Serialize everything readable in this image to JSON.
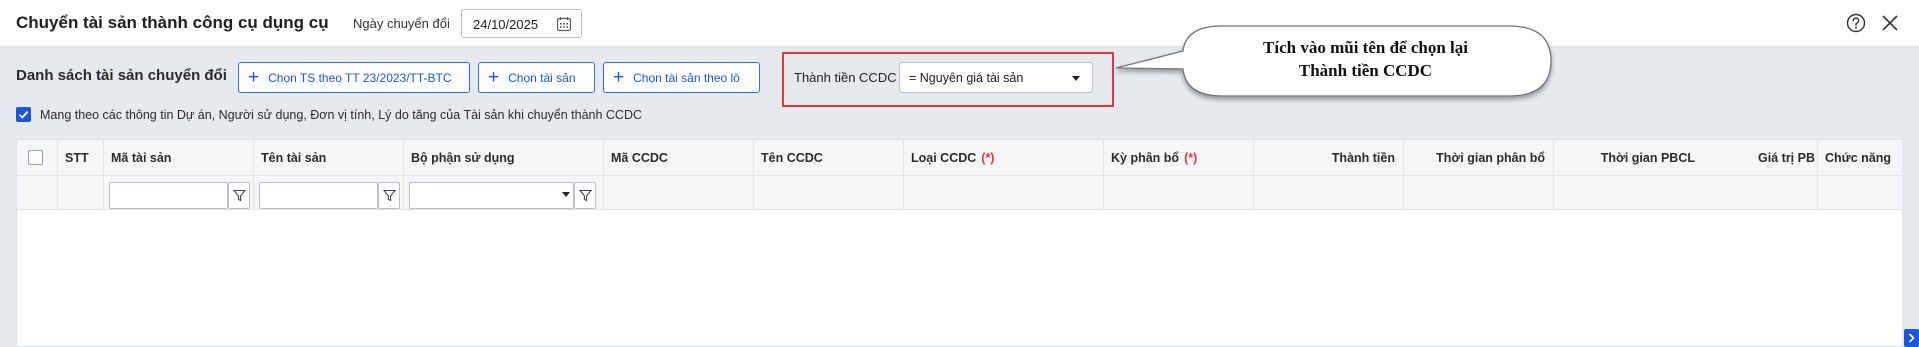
{
  "header": {
    "title": "Chuyển tài sản thành công cụ dụng cụ",
    "date_label": "Ngày chuyển đổi",
    "date_value": "24/10/2025"
  },
  "toolbar": {
    "section_title": "Danh sách tài sản chuyển đổi",
    "buttons": [
      {
        "label": "Chọn TS theo TT 23/2023/TT-BTC"
      },
      {
        "label": "Chọn tài sản"
      },
      {
        "label": "Chọn tài sản theo lô"
      }
    ],
    "ccdc_label": "Thành tiền CCDC",
    "ccdc_value": "= Nguyên giá tài sản"
  },
  "callout": {
    "line1": "Tích vào mũi tên để chọn lại",
    "line2": "Thành tiền CCDC"
  },
  "carry_option": {
    "checked": true,
    "label": "Mang theo các thông tin Dự án, Người sử dụng, Đơn vị tính, Lý do tăng của Tài sản khi chuyển thành CCDC"
  },
  "grid": {
    "columns": [
      {
        "label": "STT"
      },
      {
        "label": "Mã tài sản"
      },
      {
        "label": "Tên tài sản"
      },
      {
        "label": "Bộ phận sử dụng"
      },
      {
        "label": "Mã CCDC"
      },
      {
        "label": "Tên CCDC"
      },
      {
        "label": "Loại CCDC",
        "required": "(*)"
      },
      {
        "label": "Kỳ phân bổ",
        "required": "(*)"
      },
      {
        "label": "Thành tiền"
      },
      {
        "label": "Thời gian phân bổ"
      },
      {
        "label": "Thời gian PBCL"
      },
      {
        "label": "Giá trị PB"
      },
      {
        "label": "Chức năng"
      }
    ]
  },
  "colors": {
    "accent": "#1a56d6",
    "highlight": "#e0393e",
    "background": "#e6e9ee"
  },
  "icons": [
    "calendar-icon",
    "help-icon",
    "close-icon",
    "plus-icon",
    "filter-icon",
    "chevron-down-icon",
    "check-icon",
    "chevron-right-icon"
  ]
}
